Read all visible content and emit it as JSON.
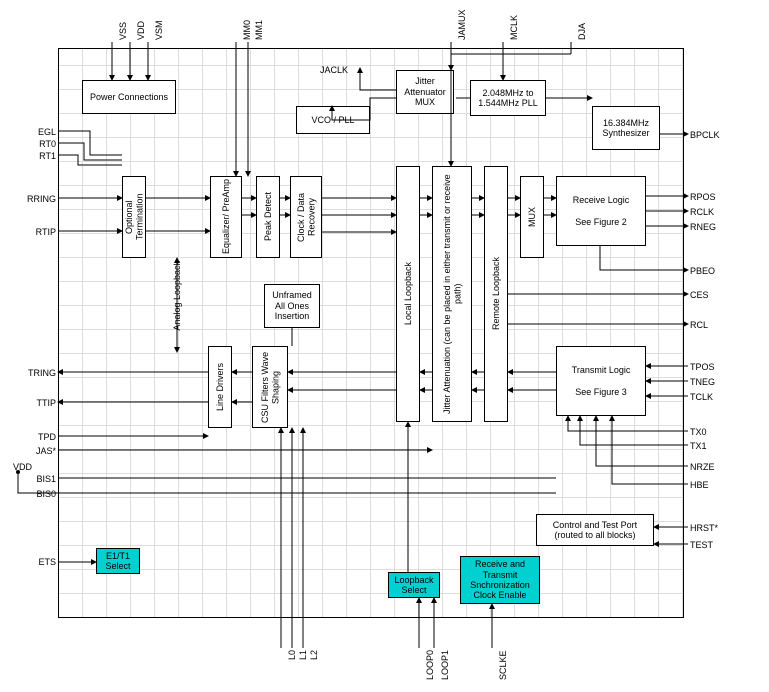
{
  "diagram_kind": "block diagram — IC functional block diagram (T1/E1 line interface / LIU)",
  "pins": {
    "top": [
      "VSS",
      "VDD",
      "VSM",
      "MM0",
      "MM1",
      "JAMUX",
      "MCLK",
      "DJA"
    ],
    "left": [
      "EGL",
      "RT0",
      "RT1",
      "RRING",
      "RTIP",
      "TRING",
      "TTIP",
      "TPD",
      "JAS*",
      "VDD",
      "BIS1",
      "BIS0",
      "ETS"
    ],
    "right": [
      "BPCLK",
      "RPOS",
      "RCLK",
      "RNEG",
      "PBEO",
      "CES",
      "RCL",
      "TPOS",
      "TNEG",
      "TCLK",
      "TX0",
      "TX1",
      "NRZE",
      "HBE",
      "HRST*",
      "TEST"
    ],
    "bottom": [
      "L0",
      "L1",
      "L2",
      "LOOP0",
      "LOOP1",
      "SCLKE"
    ]
  },
  "blocks": {
    "power": "Power Connections",
    "opt_term": "Optional Termination",
    "eq_preamp": "Equalizer/ PreAmp",
    "peak_det": "Peak Detect",
    "cdr": "Clock / Data Recovery",
    "analog_lb": "Analog Loopback",
    "jaclk": "JACLK",
    "vco_pll": "VCO / PLL",
    "ja_mux": "Jitter Attenuator MUX",
    "pll": "2.048MHz to 1.544MHz PLL",
    "synth": "16.384MHz Synthesizer",
    "mux": "MUX",
    "rx_logic": "Receive Logic",
    "rx_see": "See Figure  2",
    "local_lb": "Local Loopback",
    "ja": "Jitter Attenuation (can be placed in either transmit or receive path)",
    "remote_lb": "Remote Loopback",
    "unframed": "Unframed All Ones Insertion",
    "line_drv": "Line Drivers",
    "csu": "CSU Filters Wave Shaping",
    "tx_logic": "Transmit Logic",
    "tx_see": "See Figure  3",
    "ctrl_test": "Control and Test Port (routed to all blocks)",
    "e1t1_sel": "E1/T1 Select",
    "lb_sel": "Loopback Select",
    "rx_tx_clk": "Receive and Transmit Snchronization Clock Enable"
  }
}
